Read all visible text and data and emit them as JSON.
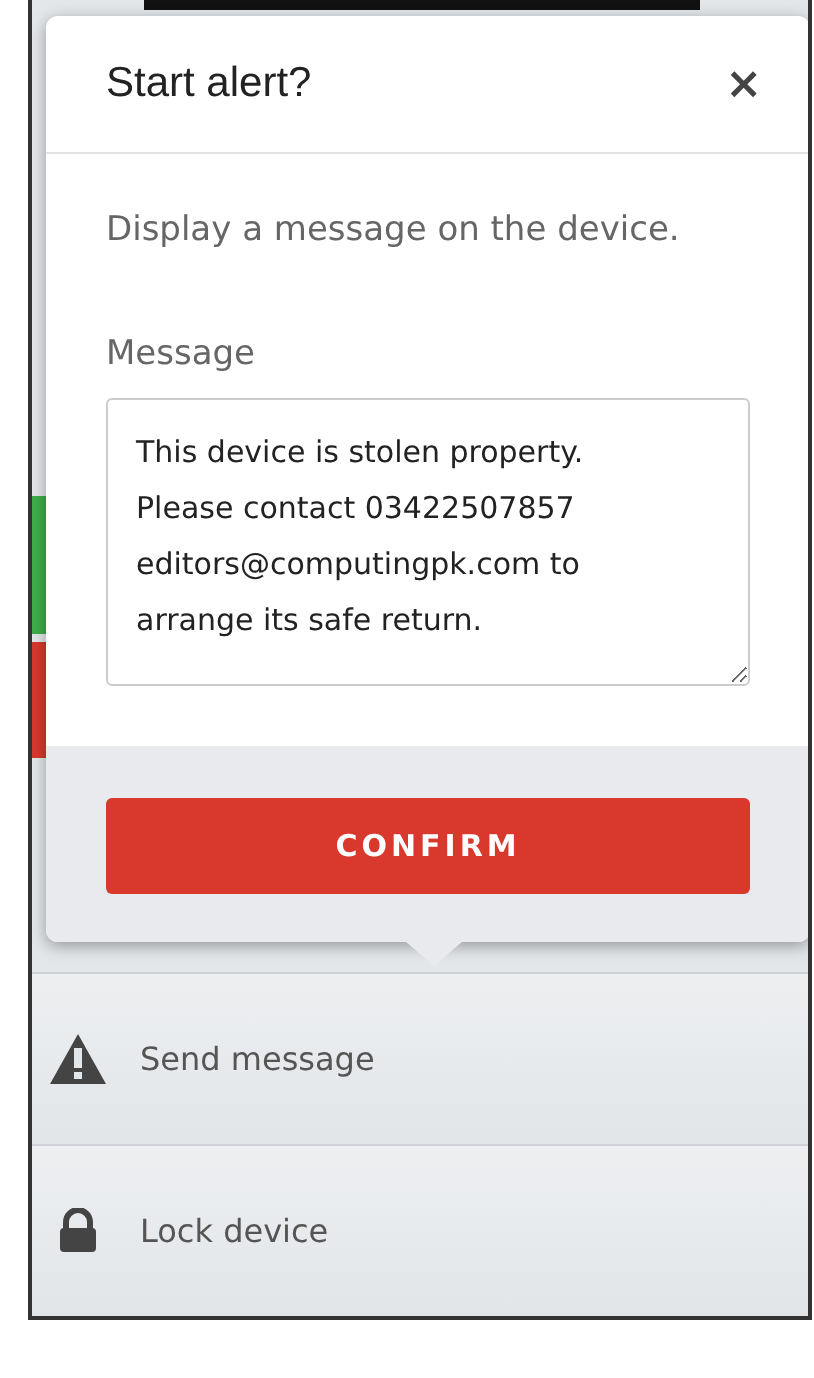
{
  "dialog": {
    "title": "Start alert?",
    "close": "×",
    "description": "Display a message on the device.",
    "message_label": "Message",
    "message": "This device is stolen property. Please contact 03422507857 editors@computingpk.com to arrange its safe return.",
    "button": "CONFIRM"
  },
  "actions": [
    {
      "kind": "warning",
      "label": "Send message"
    },
    {
      "kind": "lock",
      "label": "Lock device"
    }
  ]
}
